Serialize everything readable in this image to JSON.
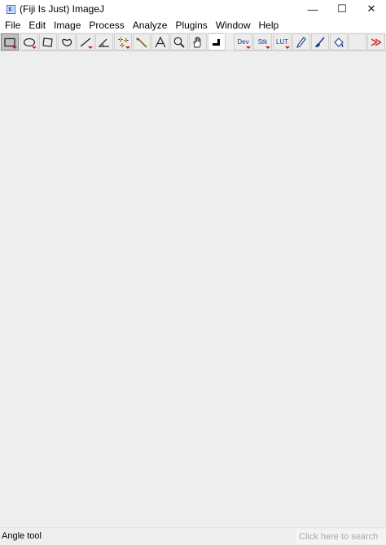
{
  "window": {
    "title": "(Fiji Is Just) ImageJ",
    "minimize_glyph": "—",
    "maximize_glyph": "☐",
    "close_glyph": "✕"
  },
  "menubar": {
    "items": [
      "File",
      "Edit",
      "Image",
      "Process",
      "Analyze",
      "Plugins",
      "Window",
      "Help"
    ]
  },
  "toolbar": {
    "tools": [
      {
        "name": "rectangle-tool",
        "icon": "rectangle-icon",
        "selected": true
      },
      {
        "name": "oval-tool",
        "icon": "oval-icon"
      },
      {
        "name": "polygon-tool",
        "icon": "polygon-icon"
      },
      {
        "name": "freehand-tool",
        "icon": "freehand-icon"
      },
      {
        "name": "line-tool",
        "icon": "line-icon"
      },
      {
        "name": "angle-tool",
        "icon": "angle-icon"
      },
      {
        "name": "point-tool",
        "icon": "point-icon"
      },
      {
        "name": "wand-tool",
        "icon": "wand-icon"
      },
      {
        "name": "text-tool",
        "icon": "text-icon"
      },
      {
        "name": "magnifier-tool",
        "icon": "magnifier-icon"
      },
      {
        "name": "hand-tool",
        "icon": "hand-icon"
      },
      {
        "name": "color-picker-tool",
        "icon": "color-picker-icon"
      },
      {
        "name": "dev-menu",
        "label": "Dev"
      },
      {
        "name": "stk-menu",
        "label": "Stk"
      },
      {
        "name": "lut-menu",
        "label": "LUT"
      },
      {
        "name": "pencil-tool",
        "icon": "pencil-icon"
      },
      {
        "name": "brush-tool",
        "icon": "brush-icon"
      },
      {
        "name": "flood-fill-tool",
        "icon": "flood-fill-icon"
      },
      {
        "name": "more-tools",
        "label": "≫",
        "color": "#d42020"
      }
    ]
  },
  "status": {
    "text": "Angle tool"
  },
  "search": {
    "placeholder": "Click here to search"
  }
}
